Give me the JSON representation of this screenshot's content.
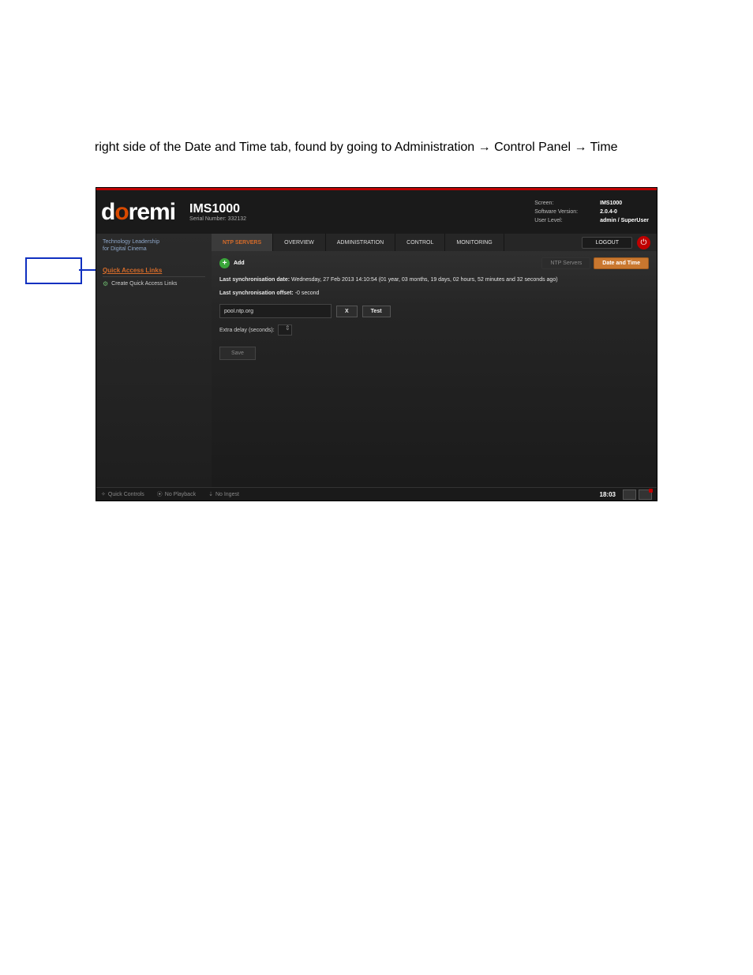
{
  "caption": "right side of the Date and Time tab, found by going to Administration → Control Panel → Time",
  "logo_d": "d",
  "logo_o": "o",
  "logo_remi": "remi",
  "product_name": "IMS1000",
  "serial_prefix": "Serial Number:",
  "serial_value": "332132",
  "hdr_screen_lab": "Screen:",
  "hdr_screen_val": "IMS1000",
  "hdr_sw_lab": "Software Version:",
  "hdr_sw_val": "2.0.4-0",
  "hdr_user_lab": "User Level:",
  "hdr_user_val": "admin / SuperUser",
  "tabs": {
    "ntp": "NTP Servers",
    "overview": "OVERVIEW",
    "admin": "ADMINISTRATION",
    "control": "CONTROL",
    "monitor": "MONITORING"
  },
  "logout": "LOGOUT",
  "tagline1": "Technology Leadership",
  "tagline2": "for Digital Cinema",
  "qal_title": "Quick Access Links",
  "qal_create": "Create Quick Access Links",
  "add_label": "Add",
  "modetab_ntp": "NTP Servers",
  "modetab_dt": "Date and Time",
  "sync_date_label": "Last synchronisation date:",
  "sync_date_value": "Wednesday, 27 Feb 2013 14:10:54 (01 year, 03 months, 19 days, 02 hours, 52 minutes and 32 seconds ago)",
  "sync_offset_label": "Last synchronisation offset:",
  "sync_offset_value": "-0 second",
  "ntp_server": "pool.ntp.org",
  "x_btn": "X",
  "test_btn": "Test",
  "extra_delay_label": "Extra delay (seconds):",
  "save_btn": "Save",
  "foot_quick": "Quick Controls",
  "foot_playback": "No Playback",
  "foot_ingest": "No Ingest",
  "clock": "18:03"
}
